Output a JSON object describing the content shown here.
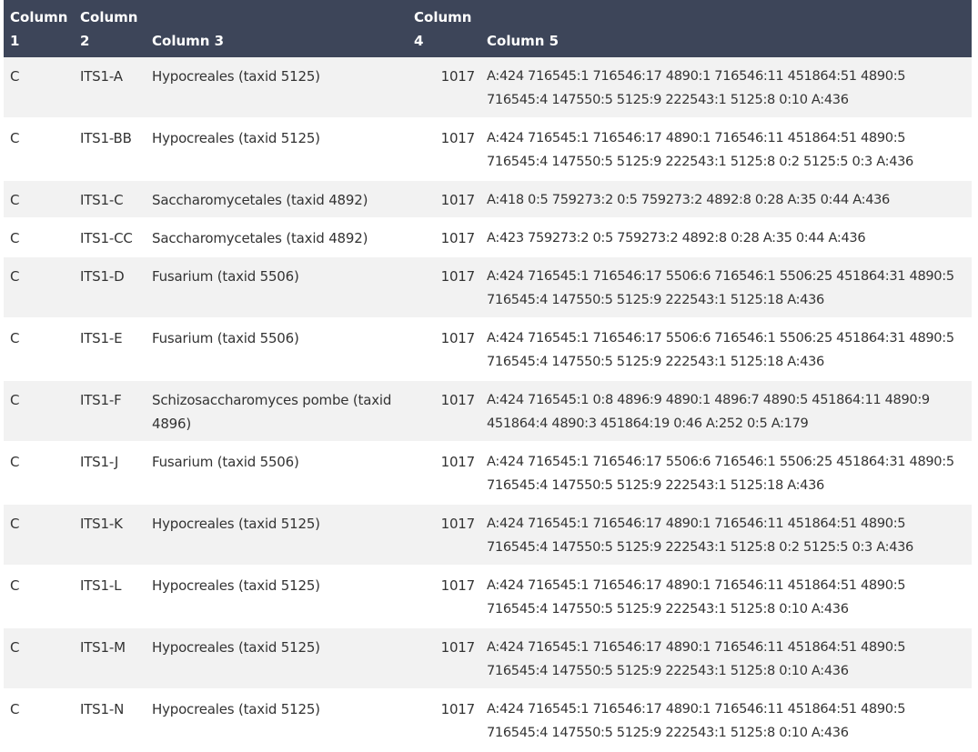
{
  "table": {
    "headers": [
      "Column 1",
      "Column 2",
      "Column 3",
      "Column 4",
      "Column 5"
    ],
    "rows": [
      [
        "C",
        "ITS1-A",
        "Hypocreales (taxid 5125)",
        "1017",
        "A:424 716545:1 716546:17 4890:1 716546:11 451864:51 4890:5 716545:4 147550:5 5125:9 222543:1 5125:8 0:10 A:436"
      ],
      [
        "C",
        "ITS1-BB",
        "Hypocreales (taxid 5125)",
        "1017",
        "A:424 716545:1 716546:17 4890:1 716546:11 451864:51 4890:5 716545:4 147550:5 5125:9 222543:1 5125:8 0:2 5125:5 0:3 A:436"
      ],
      [
        "C",
        "ITS1-C",
        "Saccharomycetales (taxid 4892)",
        "1017",
        "A:418 0:5 759273:2 0:5 759273:2 4892:8 0:28 A:35 0:44 A:436"
      ],
      [
        "C",
        "ITS1-CC",
        "Saccharomycetales (taxid 4892)",
        "1017",
        "A:423 759273:2 0:5 759273:2 4892:8 0:28 A:35 0:44 A:436"
      ],
      [
        "C",
        "ITS1-D",
        "Fusarium (taxid 5506)",
        "1017",
        "A:424 716545:1 716546:17 5506:6 716546:1 5506:25 451864:31 4890:5 716545:4 147550:5 5125:9 222543:1 5125:18 A:436"
      ],
      [
        "C",
        "ITS1-E",
        "Fusarium (taxid 5506)",
        "1017",
        "A:424 716545:1 716546:17 5506:6 716546:1 5506:25 451864:31 4890:5 716545:4 147550:5 5125:9 222543:1 5125:18 A:436"
      ],
      [
        "C",
        "ITS1-F",
        "Schizosaccharomyces pombe (taxid 4896)",
        "1017",
        "A:424 716545:1 0:8 4896:9 4890:1 4896:7 4890:5 451864:11 4890:9 451864:4 4890:3 451864:19 0:46 A:252 0:5 A:179"
      ],
      [
        "C",
        "ITS1-J",
        "Fusarium (taxid 5506)",
        "1017",
        "A:424 716545:1 716546:17 5506:6 716546:1 5506:25 451864:31 4890:5 716545:4 147550:5 5125:9 222543:1 5125:18 A:436"
      ],
      [
        "C",
        "ITS1-K",
        "Hypocreales (taxid 5125)",
        "1017",
        "A:424 716545:1 716546:17 4890:1 716546:11 451864:51 4890:5 716545:4 147550:5 5125:9 222543:1 5125:8 0:2 5125:5 0:3 A:436"
      ],
      [
        "C",
        "ITS1-L",
        "Hypocreales (taxid 5125)",
        "1017",
        "A:424 716545:1 716546:17 4890:1 716546:11 451864:51 4890:5 716545:4 147550:5 5125:9 222543:1 5125:8 0:10 A:436"
      ],
      [
        "C",
        "ITS1-M",
        "Hypocreales (taxid 5125)",
        "1017",
        "A:424 716545:1 716546:17 4890:1 716546:11 451864:51 4890:5 716545:4 147550:5 5125:9 222543:1 5125:8 0:10 A:436"
      ],
      [
        "C",
        "ITS1-N",
        "Hypocreales (taxid 5125)",
        "1017",
        "A:424 716545:1 716546:17 4890:1 716546:11 451864:51 4890:5 716545:4 147550:5 5125:9 222543:1 5125:8 0:10 A:436"
      ]
    ]
  },
  "colors": {
    "header_bg": "#3d4559",
    "header_text": "#ffffff",
    "row_alt_bg": "#f2f2f2",
    "row_bg": "#ffffff",
    "text": "#333333"
  }
}
